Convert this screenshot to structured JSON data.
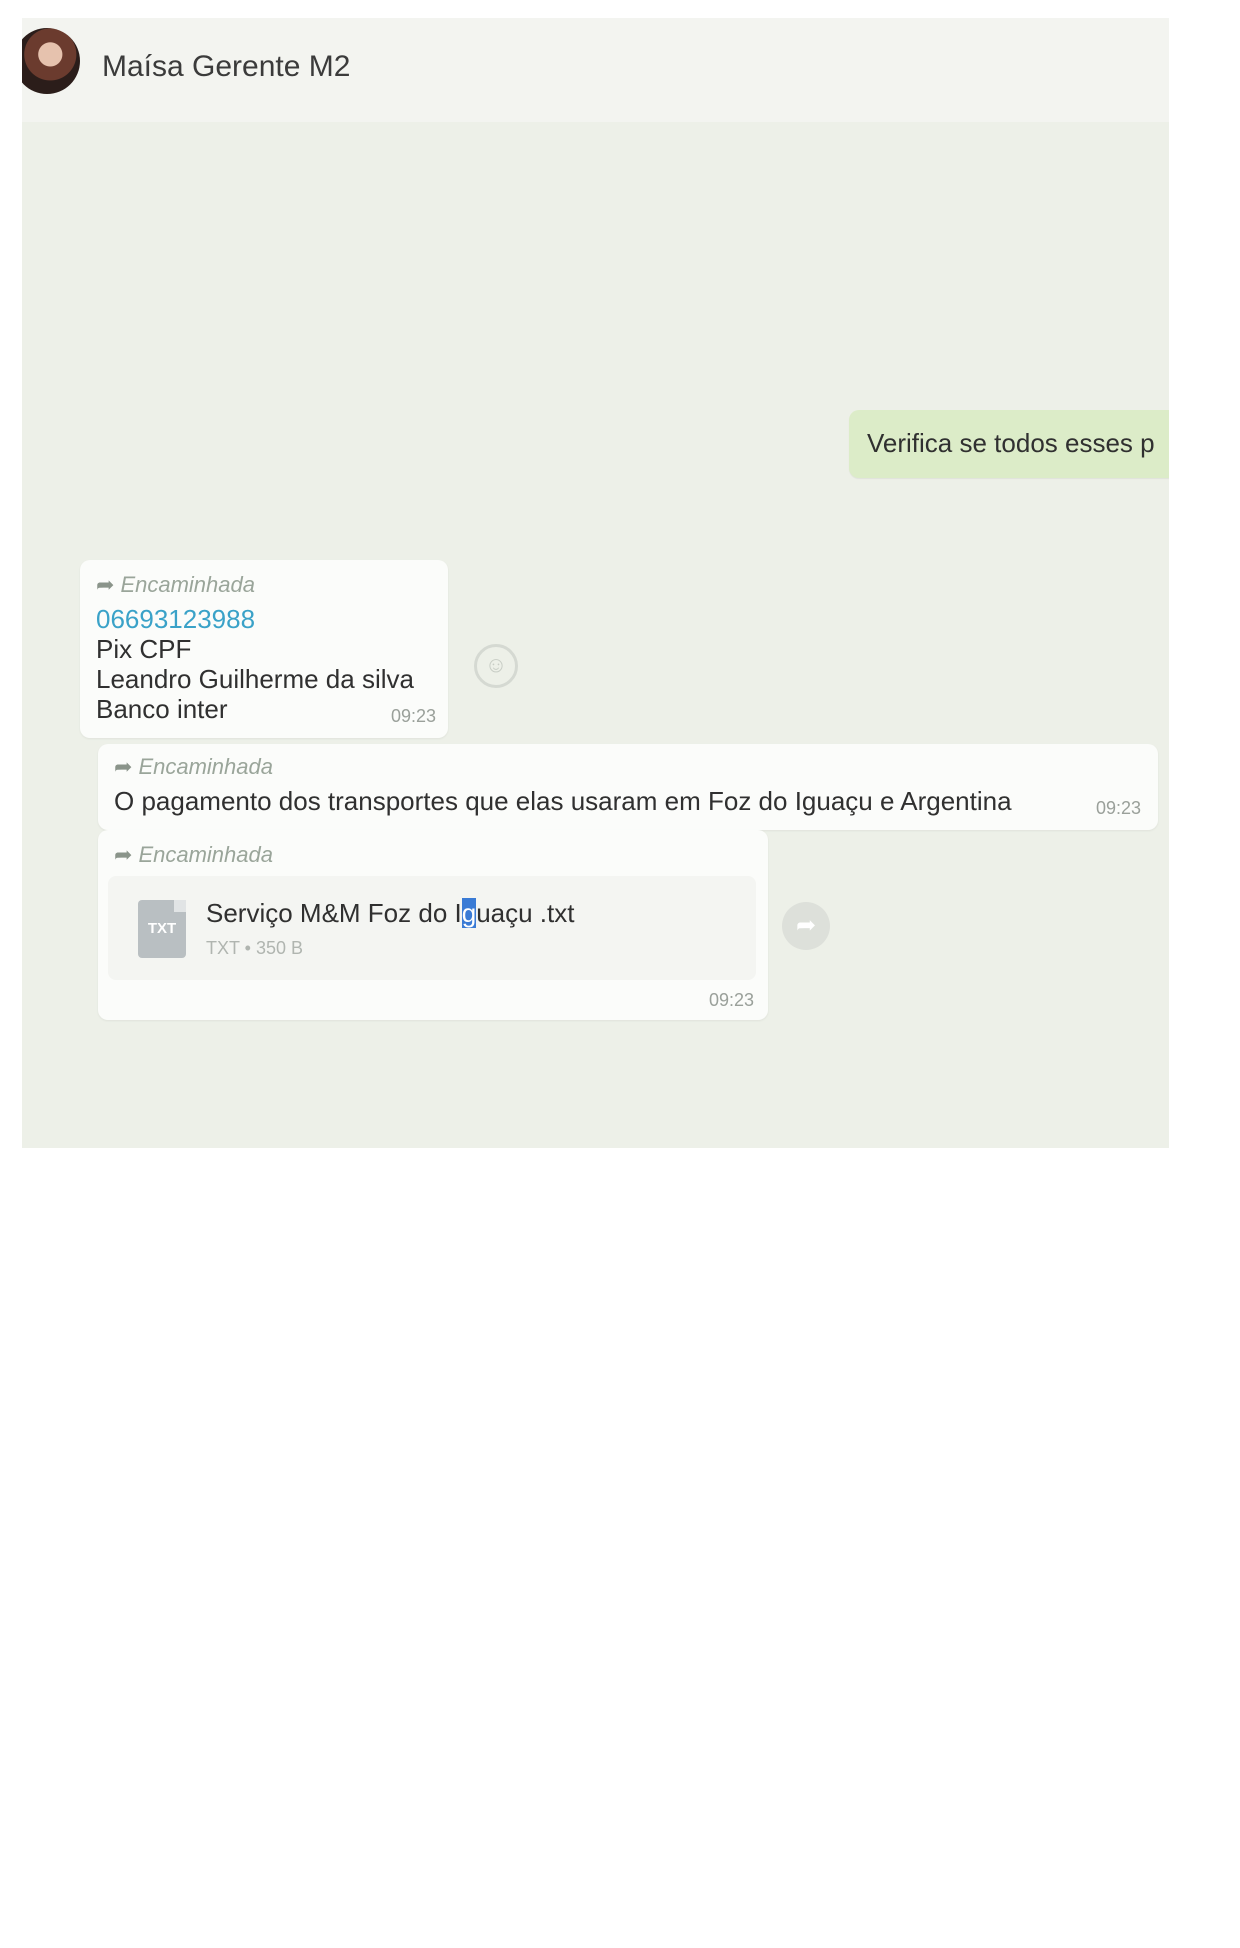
{
  "header": {
    "contact_name": "Maísa Gerente M2"
  },
  "messages": {
    "outgoing": {
      "text": "Verifica se todos esses p"
    },
    "forwarded_label": "Encaminhada",
    "msg1": {
      "phone": "06693123988",
      "line2": "Pix CPF",
      "line3": "Leandro Guilherme da silva",
      "line4": "Banco inter",
      "time": "09:23"
    },
    "msg2": {
      "text": "O pagamento dos transportes que elas usaram em Foz do Iguaçu e Argentina",
      "time": "09:23"
    },
    "msg3": {
      "file_name_before": "Serviço M&M Foz do I",
      "file_name_selected": "g",
      "file_name_after": "uaçu .txt",
      "file_type_badge": "TXT",
      "file_meta": "TXT • 350 B",
      "time": "09:23"
    }
  },
  "icons": {
    "forward": "forward-arrow-icon",
    "emoji": "emoji-icon",
    "share": "share-icon",
    "file": "file-icon"
  }
}
